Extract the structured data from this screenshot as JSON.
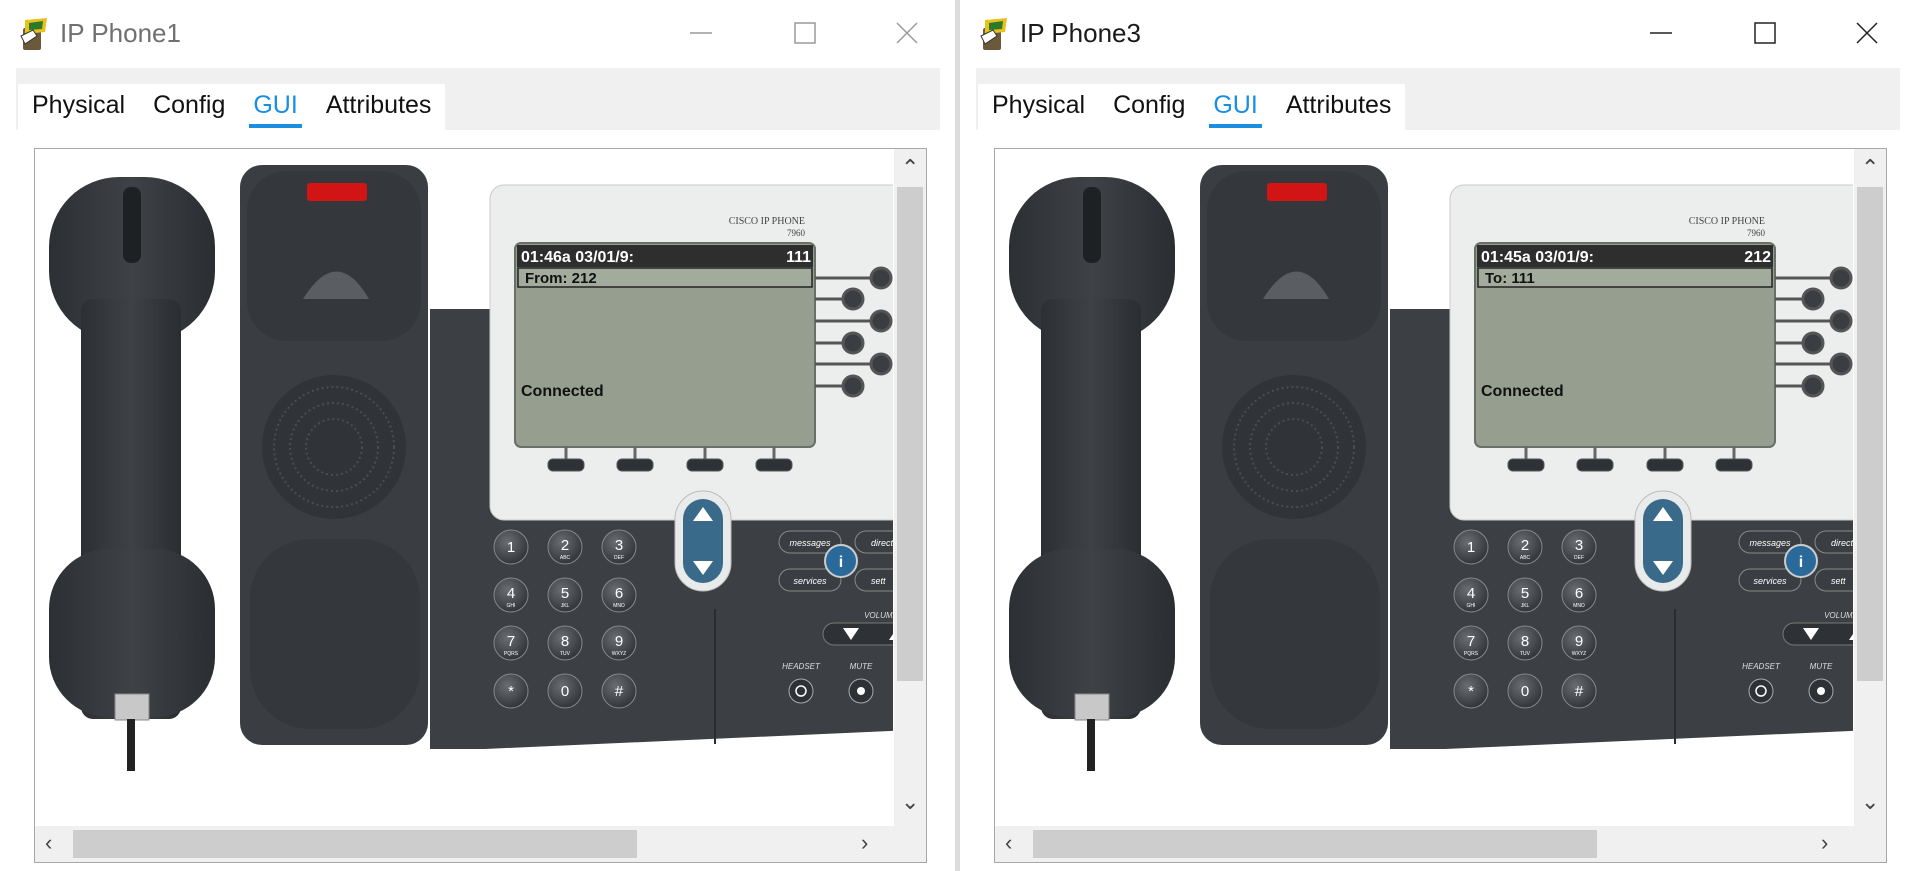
{
  "windows": [
    {
      "title": "IP Phone1",
      "tabs": [
        "Physical",
        "Config",
        "GUI",
        "Attributes"
      ],
      "active_tab": "GUI",
      "screen": {
        "clock": "01:46a 03/01/9:",
        "line": "111",
        "party": "From: 212",
        "status": "Connected"
      }
    },
    {
      "title": "IP Phone3",
      "tabs": [
        "Physical",
        "Config",
        "GUI",
        "Attributes"
      ],
      "active_tab": "GUI",
      "screen": {
        "clock": "01:45a 03/01/9:",
        "line": "212",
        "party": "To: 111",
        "status": "Connected"
      }
    }
  ],
  "phone": {
    "brand": "CISCO IP PHONE",
    "model": "7960",
    "keys": [
      {
        "digit": "1",
        "letters": ""
      },
      {
        "digit": "2",
        "letters": "ABC"
      },
      {
        "digit": "3",
        "letters": "DEF"
      },
      {
        "digit": "4",
        "letters": "GHI"
      },
      {
        "digit": "5",
        "letters": "JKL"
      },
      {
        "digit": "6",
        "letters": "MNO"
      },
      {
        "digit": "7",
        "letters": "PQRS"
      },
      {
        "digit": "8",
        "letters": "TUV"
      },
      {
        "digit": "9",
        "letters": "WXYZ"
      },
      {
        "digit": "*",
        "letters": ""
      },
      {
        "digit": "0",
        "letters": ""
      },
      {
        "digit": "#",
        "letters": ""
      }
    ],
    "buttons": {
      "messages": "messages",
      "directories": "direct",
      "services": "services",
      "settings": "sett",
      "info": "i",
      "volume": "VOLUME",
      "headset": "HEADSET",
      "mute": "MUTE"
    }
  },
  "colors": {
    "accent": "#1a8fe0",
    "screen_bg": "#969f8f",
    "phone_body": "#3c4044",
    "handset": "#34383c",
    "indicator": "#d21414"
  }
}
